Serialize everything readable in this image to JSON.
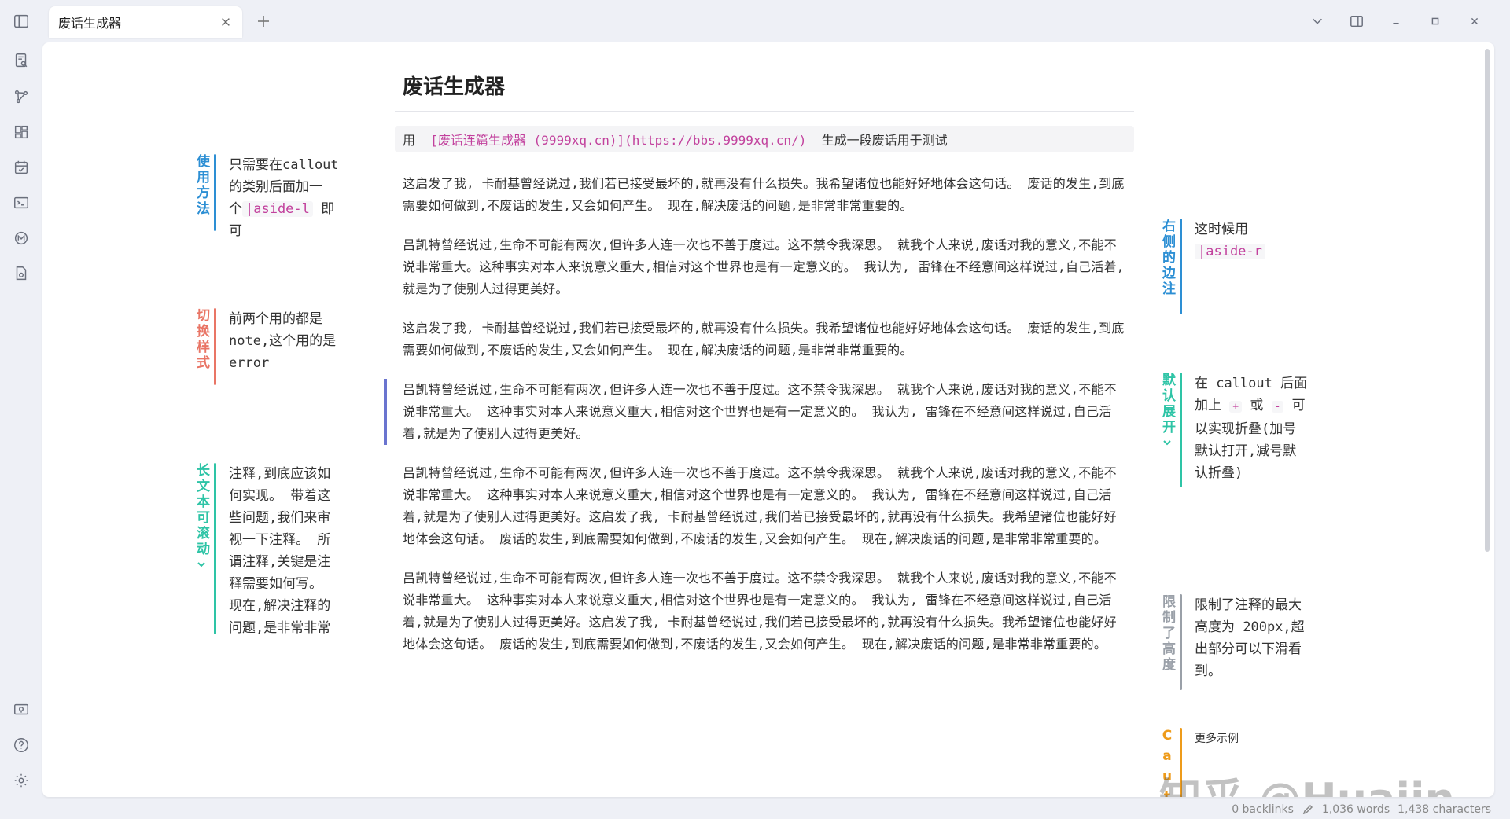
{
  "tab": {
    "title": "废话生成器"
  },
  "doc": {
    "title": "废话生成器",
    "codeline": {
      "prefix": "用",
      "link": "[废话连篇生成器 (9999xq.cn)](https://bbs.9999xq.cn/)",
      "suffix": "生成一段废话用于测试"
    },
    "paragraphs": [
      "这启发了我, 卡耐基曾经说过,我们若已接受最坏的,就再没有什么损失。我希望诸位也能好好地体会这句话。 废话的发生,到底需要如何做到,不废话的发生,又会如何产生。 现在,解决废话的问题,是非常非常重要的。",
      "吕凯特曾经说过,生命不可能有两次,但许多人连一次也不善于度过。这不禁令我深思。 就我个人来说,废话对我的意义,不能不说非常重大。这种事实对本人来说意义重大,相信对这个世界也是有一定意义的。 我认为, 雷锋在不经意间这样说过,自己活着,就是为了使别人过得更美好。",
      "这启发了我, 卡耐基曾经说过,我们若已接受最坏的,就再没有什么损失。我希望诸位也能好好地体会这句话。 废话的发生,到底需要如何做到,不废话的发生,又会如何产生。 现在,解决废话的问题,是非常非常重要的。",
      "吕凯特曾经说过,生命不可能有两次,但许多人连一次也不善于度过。这不禁令我深思。 就我个人来说,废话对我的意义,不能不说非常重大。 这种事实对本人来说意义重大,相信对这个世界也是有一定意义的。 我认为, 雷锋在不经意间这样说过,自己活着,就是为了使别人过得更美好。",
      "吕凯特曾经说过,生命不可能有两次,但许多人连一次也不善于度过。这不禁令我深思。 就我个人来说,废话对我的意义,不能不说非常重大。 这种事实对本人来说意义重大,相信对这个世界也是有一定意义的。 我认为, 雷锋在不经意间这样说过,自己活着,就是为了使别人过得更美好。这启发了我, 卡耐基曾经说过,我们若已接受最坏的,就再没有什么损失。我希望诸位也能好好地体会这句话。 废话的发生,到底需要如何做到,不废话的发生,又会如何产生。 现在,解决废话的问题,是非常非常重要的。",
      "吕凯特曾经说过,生命不可能有两次,但许多人连一次也不善于度过。这不禁令我深思。 就我个人来说,废话对我的意义,不能不说非常重大。 这种事实对本人来说意义重大,相信对这个世界也是有一定意义的。 我认为, 雷锋在不经意间这样说过,自己活着,就是为了使别人过得更美好。这启发了我, 卡耐基曾经说过,我们若已接受最坏的,就再没有什么损失。我希望诸位也能好好地体会这句话。 废话的发生,到底需要如何做到,不废话的发生,又会如何产生。 现在,解决废话的问题,是非常非常重要的。"
    ]
  },
  "asides_left": [
    {
      "title": "使用方法",
      "body_pre": "只需要在callout的类别后面加一个",
      "code": "|aside-l",
      "body_post": " 即可",
      "color": "#2d8fd4"
    },
    {
      "title": "切换样式",
      "body": "前两个用的都是note,这个用的是error",
      "color": "#e97565"
    },
    {
      "title": "长文本可滚动",
      "body": "注释,到底应该如何实现。 带着这些问题,我们来审视一下注释。 所谓注释,关键是注释需要如何写。 现在,解决注释的问题,是非常非常重要的。 所以, 我们",
      "color": "#2ec4a6"
    }
  ],
  "asides_right": [
    {
      "title": "右侧的边注",
      "body_pre": "这时候用",
      "code": "|aside-r",
      "color": "#2d8fd4"
    },
    {
      "title": "默认展开",
      "body_a": "在 callout 后面加上",
      "plus": "+",
      "or": "或",
      "minus": "-",
      "body_b": "可以实现折叠(加号默认打开,减号默认折叠)",
      "color": "#2ec4a6"
    },
    {
      "title": "限制了高度",
      "body": "限制了注释的最大高度为 200px,超出部分可以下滑看到。",
      "color": "#9aa0a8"
    },
    {
      "title": "Caut",
      "body": "更多示例",
      "color": "#ee9b1a"
    }
  ],
  "status": {
    "backlinks": "0 backlinks",
    "words": "1,036 words",
    "characters": "1,438 characters"
  },
  "watermark": "知乎 @Huajin"
}
